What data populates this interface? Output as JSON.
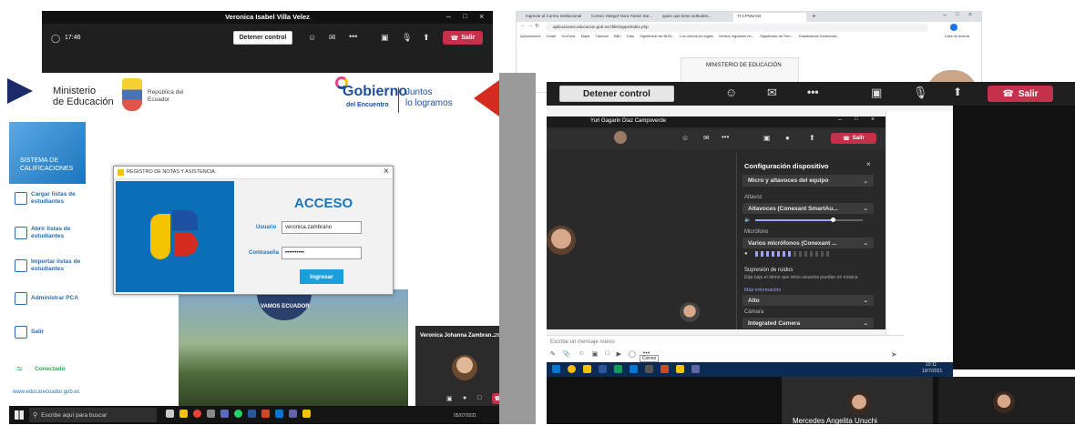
{
  "left_teams": {
    "title": "Veronica Isabel Villa Velez",
    "time": "17:46",
    "stop_control": "Detener control",
    "leave": "Salir"
  },
  "ministry": {
    "name_line1": "Ministerio",
    "name_line2": "de Educación",
    "republic": "República del Ecuador",
    "gobierno": "Gobierno",
    "del_encuentro": "del Encuentro",
    "juntos1": "Juntos",
    "juntos2": "lo logramos"
  },
  "sidebar": {
    "system_title": "SISTEMA DE CALIFICACIONES",
    "items": [
      {
        "label": "Cargar listas de estudiantes"
      },
      {
        "label": "Abrir listas de estudiantes"
      },
      {
        "label": "Importar listas de estudiantes"
      },
      {
        "label": "Administrar PCA"
      },
      {
        "label": "Salir"
      }
    ],
    "connected": "Conectado",
    "website": "www.educarecuador.gob.ec"
  },
  "login_dialog": {
    "title": "REGISTRO DE NOTAS Y ASISTENCIA",
    "heading": "ACCESO",
    "user_label": "Usuario",
    "user_value": "veronica.zambrano",
    "pass_label": "Contraseña",
    "pass_value": "••••••••••",
    "submit": "Ingresar",
    "close": "×"
  },
  "banner_text": "VAMOS ECUADOR",
  "participant_tile": {
    "name": "Veronica Johanna Zambran...",
    "time": "28:01"
  },
  "taskbar_left": {
    "search_placeholder": "Escribe aquí para buscar",
    "date": "05/07/2021"
  },
  "browser": {
    "tabs": [
      "Ingresar al Correo Institucional",
      "Correo: Margot Nora Yánez Sar...",
      "quien que tiene actitudes...",
      "TI-CPNNA02"
    ],
    "url": "aplicaciones.educacion.gob.ec/cfiles/apps/index.php",
    "bookmarks": [
      "Aplicaciones",
      "Gmail",
      "YouTube",
      "Maps",
      "Traducir",
      "BBC",
      "Ediu",
      "Significado de BUN...",
      "Los verbos en inglés",
      "Verbos regulares en...",
      "Significado de Ren...",
      "Estadísticas Dinámicas..."
    ],
    "bookmarks_more": "Lista de lectura",
    "ministry_text": "MINISTERIO DE EDUCACIÓN"
  },
  "right_teams": {
    "stop_control": "Detener control",
    "leave": "Salir"
  },
  "inner_teams": {
    "title": "Yuri Gagarin Diaz Campoverde",
    "leave": "Salir"
  },
  "device_settings": {
    "title": "Configuración dispositivo",
    "audio_device": "Micro y altavoces del equipo",
    "speaker_label": "Altavoz",
    "speaker_value": "Altavoces (Conexant SmartAu...",
    "mic_label": "Micrófono",
    "mic_value": "Varios micrófonos (Conexant ...",
    "noise_label": "Supresión de ruidos",
    "noise_desc": "Elija bajo el demo que otros usuarios puedan oír música",
    "more_info": "Más información",
    "noise_value": "Alto",
    "camera_label": "Cámara",
    "camera_value": "Integrated Camera"
  },
  "chat": {
    "placeholder": "Escribe un mensaje nuevo"
  },
  "taskbar_right": {
    "tooltip": "Correo",
    "time": "10:11",
    "date": "19/7/2021"
  },
  "participants_right": {
    "name": "Mercedes Angelita Unuchi"
  },
  "colors": {
    "teams_dark": "#1f1f1f",
    "teams_red": "#c4314b",
    "ministry_blue": "#2b6cb0",
    "acceso_blue": "#1b75bb",
    "dialog_blue": "#0b6fb8",
    "flag_yellow": "#f5c400",
    "flag_blue": "#1d4fa3",
    "flag_red": "#d52b1e"
  }
}
